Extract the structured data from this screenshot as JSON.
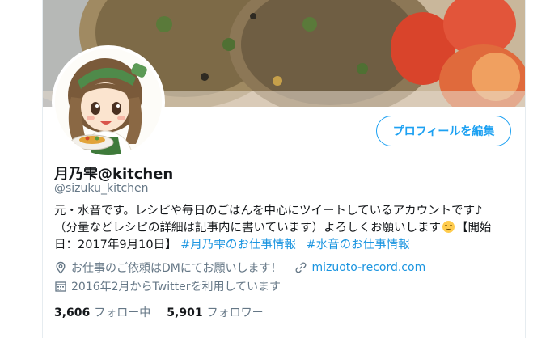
{
  "profile": {
    "display_name": "月乃雫@kitchen",
    "handle": "@sizuku_kitchen",
    "edit_button_label": "プロフィールを編集",
    "bio_line1": "元・水音です。レシピや毎日のごはんを中心にツイートしているアカウントです♪",
    "bio_line2": "（分量などレシピの詳細は記事内に書いています）よろしくお願いします",
    "bio_line2_tail": "【開始",
    "bio_line3": "日：2017年9月10日】",
    "hashtag1": "#月乃雫のお仕事情報",
    "hashtag2": "#水音のお仕事情報",
    "location": "お仕事のご依頼はDMにてお願いします！",
    "website": "mizuoto-record.com",
    "joined": "2016年2月からTwitterを利用しています",
    "following_count": "3,606",
    "following_label": "フォロー中",
    "followers_count": "5,901",
    "followers_label": "フォロワー"
  },
  "icons": {
    "location": "location-pin-icon",
    "website": "link-icon",
    "joined": "calendar-icon",
    "emoji": "smiling-face-emoji"
  },
  "colors": {
    "accent": "#1da1f2",
    "link": "#1b95e0",
    "secondary_text": "#657786",
    "primary_text": "#14171a"
  }
}
